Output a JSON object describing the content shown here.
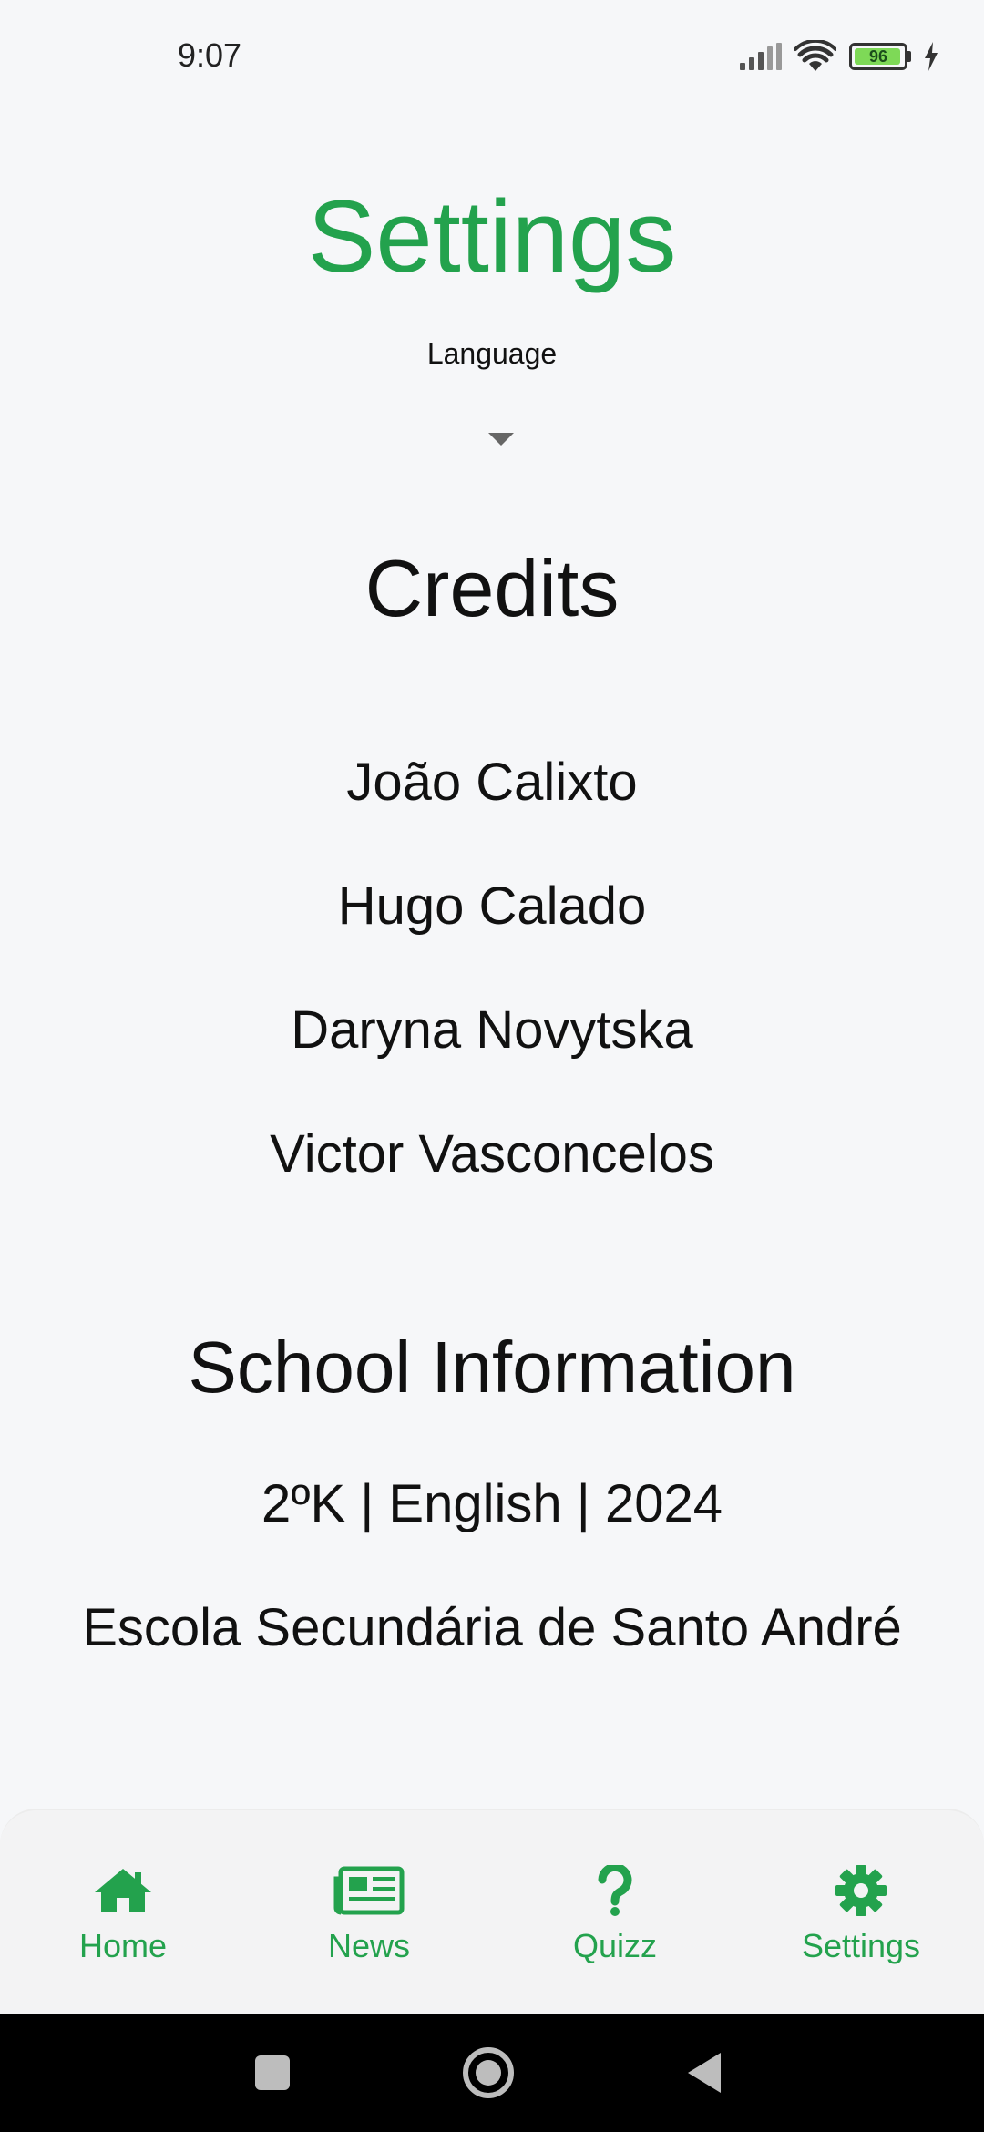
{
  "status_bar": {
    "time": "9:07",
    "battery_level": "96",
    "battery_fill_fraction": 0.96,
    "icons": [
      "signal-icon",
      "wifi-icon",
      "battery-icon",
      "charging-icon"
    ]
  },
  "page": {
    "title": "Settings",
    "language_label": "Language",
    "language_selected": ""
  },
  "credits": {
    "heading": "Credits",
    "names": [
      "João Calixto",
      "Hugo Calado",
      "Daryna Novytska",
      "Victor Vasconcelos"
    ]
  },
  "school": {
    "heading": "School Information",
    "class_info": "2ºK | English | 2024",
    "school_name": "Escola Secundária de Santo André"
  },
  "bottom_nav": {
    "items": [
      {
        "label": "Home",
        "icon": "home-icon"
      },
      {
        "label": "News",
        "icon": "newspaper-icon"
      },
      {
        "label": "Quizz",
        "icon": "question-icon"
      },
      {
        "label": "Settings",
        "icon": "gear-icon"
      }
    ]
  },
  "colors": {
    "accent": "#23a24d",
    "background": "#f6f7f9",
    "text": "#111111"
  }
}
